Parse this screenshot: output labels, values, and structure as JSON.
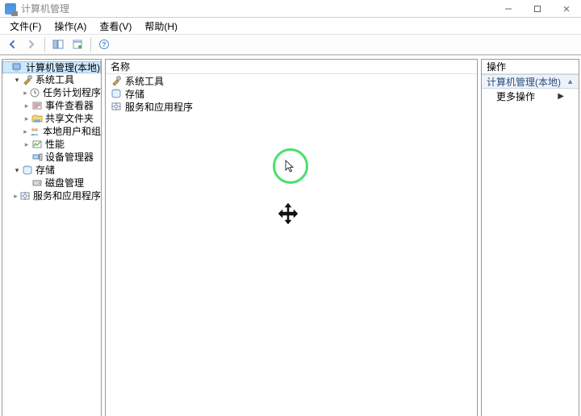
{
  "window": {
    "title": "计算机管理"
  },
  "menu": {
    "file": "文件(F)",
    "action": "操作(A)",
    "view": "查看(V)",
    "help": "帮助(H)"
  },
  "tree": {
    "root": "计算机管理(本地)",
    "system_tools": "系统工具",
    "task_scheduler": "任务计划程序",
    "event_viewer": "事件查看器",
    "shared_folders": "共享文件夹",
    "local_users": "本地用户和组",
    "performance": "性能",
    "device_manager": "设备管理器",
    "storage": "存储",
    "disk_management": "磁盘管理",
    "services_apps": "服务和应用程序"
  },
  "content": {
    "col_name": "名称",
    "row_system_tools": "系统工具",
    "row_storage": "存储",
    "row_services_apps": "服务和应用程序"
  },
  "actions": {
    "header": "操作",
    "group_title": "计算机管理(本地)",
    "more_actions": "更多操作"
  }
}
